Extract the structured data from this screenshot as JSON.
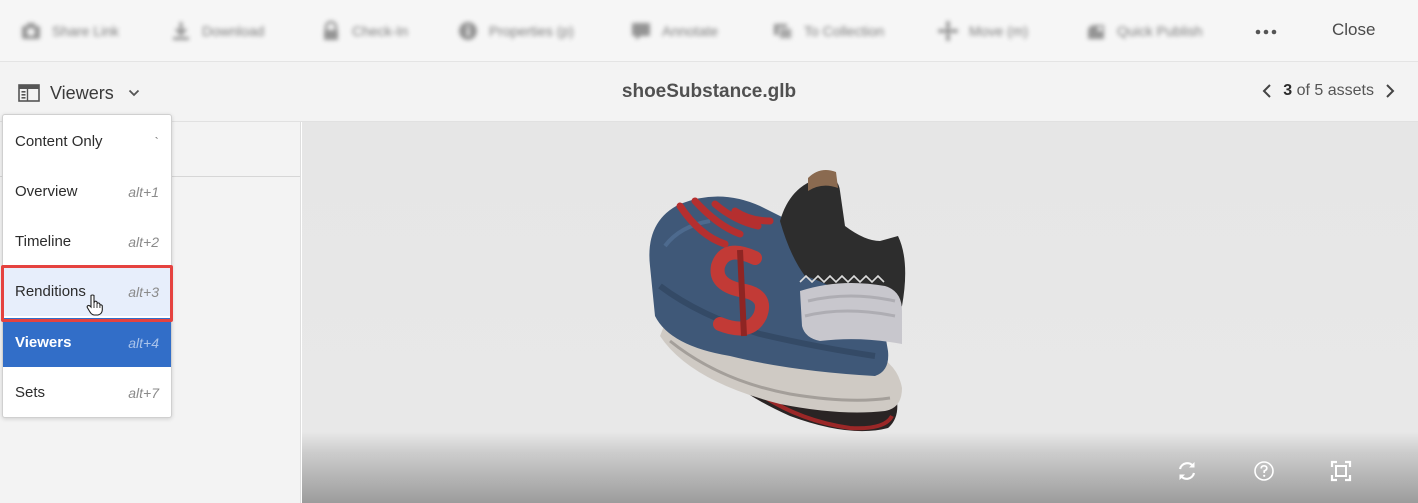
{
  "actionbar": {
    "actions": [
      {
        "label": "Share Link",
        "icon": "share-link-icon"
      },
      {
        "label": "Download",
        "icon": "download-icon"
      },
      {
        "label": "Check-In",
        "icon": "lock-icon"
      },
      {
        "label": "Properties (p)",
        "icon": "info-icon"
      },
      {
        "label": "Annotate",
        "icon": "annotate-icon"
      },
      {
        "label": "To Collection",
        "icon": "collection-icon"
      },
      {
        "label": "Move (m)",
        "icon": "move-icon"
      },
      {
        "label": "Quick Publish",
        "icon": "publish-icon"
      }
    ],
    "more_icon": "ellipsis-icon",
    "close_label": "Close"
  },
  "subbar": {
    "rail_label": "Viewers",
    "title": "shoeSubstance.glb",
    "pager": {
      "current": "3",
      "suffix": "of 5 assets"
    }
  },
  "menu": {
    "items": [
      {
        "label": "Content Only",
        "shortcut": "`"
      },
      {
        "label": "Overview",
        "shortcut": "alt+1"
      },
      {
        "label": "Timeline",
        "shortcut": "alt+2"
      },
      {
        "label": "Renditions",
        "shortcut": "alt+3"
      },
      {
        "label": "Viewers",
        "shortcut": "alt+4"
      },
      {
        "label": "Sets",
        "shortcut": "alt+7"
      }
    ],
    "selected": "Viewers",
    "hovered": "Renditions"
  },
  "viewer": {
    "controls": [
      "reset-icon",
      "help-icon",
      "fullscreen-icon"
    ]
  },
  "colors": {
    "selected_bg": "#326ec8",
    "highlight_border": "#e5423f",
    "toolbar_bg": "#f6f6f6"
  }
}
